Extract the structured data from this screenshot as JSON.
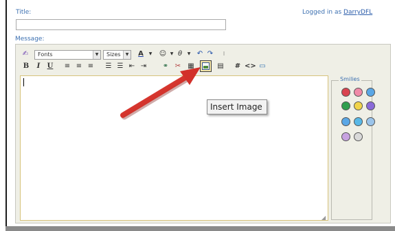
{
  "form": {
    "title_label": "Title:",
    "title_value": "",
    "message_label": "Message:",
    "login_prefix": "Logged in as",
    "login_user": "DarryDFL"
  },
  "toolbar": {
    "font_select": "Fonts",
    "size_select": "Sizes",
    "row1_icons": [
      "styles-icon",
      "font-color-icon",
      "emoticon-icon",
      "special-char-icon",
      "undo-icon",
      "redo-icon"
    ],
    "row2_icons": [
      "bold-icon",
      "italic-icon",
      "underline-icon",
      "align-left-icon",
      "align-center-icon",
      "align-right-icon",
      "ordered-list-icon",
      "unordered-list-icon",
      "outdent-icon",
      "indent-icon",
      "link-icon",
      "unlink-icon",
      "insert-table-icon",
      "insert-image-icon",
      "quote-icon",
      "hash-icon",
      "code-icon",
      "source-icon"
    ],
    "bold": "B",
    "italic": "I",
    "underline": "U",
    "hash": "#",
    "code": "<>"
  },
  "smilies": {
    "title": "Smilies",
    "colors": [
      "#d9434f",
      "#f08aa8",
      "#5aa7e6",
      "#2f9f4d",
      "#f1d34a",
      "#8a6ad8",
      "#5aa7e6",
      "#59b8e6",
      "#9bc4ea",
      "#c7a2e0"
    ]
  },
  "tooltip": "Insert Image",
  "colors": {
    "label": "#3b6fb0",
    "toolbar_bg": "#efefe6",
    "arrow": "#e23b32"
  }
}
